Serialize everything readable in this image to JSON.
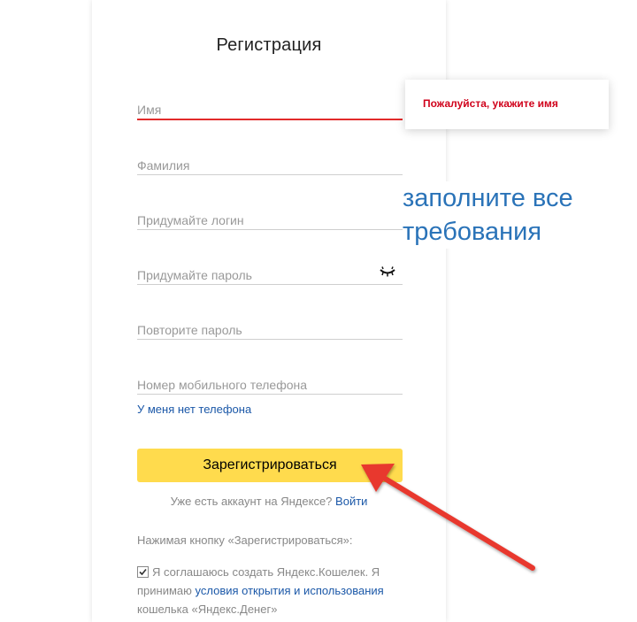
{
  "form": {
    "title": "Регистрация",
    "fields": {
      "first_name": {
        "placeholder": "Имя"
      },
      "last_name": {
        "placeholder": "Фамилия"
      },
      "login": {
        "placeholder": "Придумайте логин"
      },
      "password": {
        "placeholder": "Придумайте пароль"
      },
      "password_repeat": {
        "placeholder": "Повторите пароль"
      },
      "phone": {
        "placeholder": "Номер мобильного телефона"
      }
    },
    "no_phone_link": "У меня нет телефона",
    "register_button": "Зарегистрироваться",
    "account_prompt": "Уже есть аккаунт на Яндексе?",
    "login_link": "Войти",
    "notice": "Нажимая кнопку «Зарегистрироваться»:",
    "agree_text_1": "Я соглашаюсь создать Яндекс.Кошелек. Я принимаю",
    "agree_link": "условия открытия и использования",
    "agree_text_2": "кошелька «Яндекс.Денег»",
    "agree_checked": true
  },
  "tooltip": {
    "text": "Пожалуйста, укажите имя"
  },
  "annotation": {
    "line1": "заполните все",
    "line2": "требования"
  },
  "colors": {
    "accent_button": "#ffdb4d",
    "error": "#e22b2b",
    "link": "#1b58a8",
    "annotation": "#2a73b8",
    "arrow": "#e8392e"
  },
  "icons": {
    "password_toggle": "eye-closed-icon",
    "arrow": "red-arrow-annotation"
  }
}
